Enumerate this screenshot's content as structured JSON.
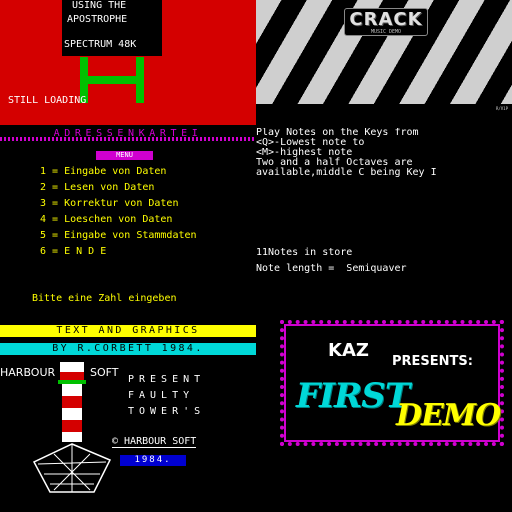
{
  "panel1": {
    "line1": "USING THE",
    "line2": "APOSTROPHE",
    "line3": "SPECTRUM 48K",
    "status": "STILL LOADING",
    "colors": {
      "background": "#d40000",
      "post": "#00c000",
      "text": "#ffffff"
    }
  },
  "panel2": {
    "logo": "CRACK",
    "logo_sub": "MUSIC DEMO",
    "corner": "R/V1P"
  },
  "panel3": {
    "header": "ADRESSENKARTEI",
    "menu_header": "MENU",
    "items": [
      "1 = Eingabe von Daten",
      "2 = Lesen von Daten",
      "3 = Korrektur von Daten",
      "4 = Loeschen von Daten",
      "5 = Eingabe von Stammdaten",
      "6 = E N D E"
    ],
    "prompt": "Bitte eine Zahl eingeben",
    "colors": {
      "header": "#d000d0",
      "items": "#ffff00"
    }
  },
  "panel4": {
    "line1": "Play Notes on the Keys from",
    "line2": "<Q>-Lowest note to",
    "line3": "<M>-highest note",
    "line4": "Two and a half Octaves are",
    "line5": "available,middle C being Key I",
    "store": "11Notes in store",
    "length": "Note length =  Semiquaver"
  },
  "panel5": {
    "bar1": "TEXT AND GRAPHICS",
    "bar2": "BY R.CORBETT 1984.",
    "brand_left": "HARBOUR",
    "brand_right": "SOFT",
    "present": [
      "PRESENT",
      "FAULTY",
      "TOWER'S"
    ],
    "copyright": "© HARBOUR SOFT",
    "year": "1984.",
    "colors": {
      "bar1": "#ffff00",
      "bar2": "#00d8d8",
      "year_bg": "#0000d0"
    }
  },
  "panel6": {
    "kaz": "KAZ",
    "presents": "PRESENTS:",
    "first": "FIRST",
    "demo": "DEMO",
    "colors": {
      "frame": "#d000d0",
      "first": "#00d8d8",
      "demo": "#ffff00"
    }
  }
}
